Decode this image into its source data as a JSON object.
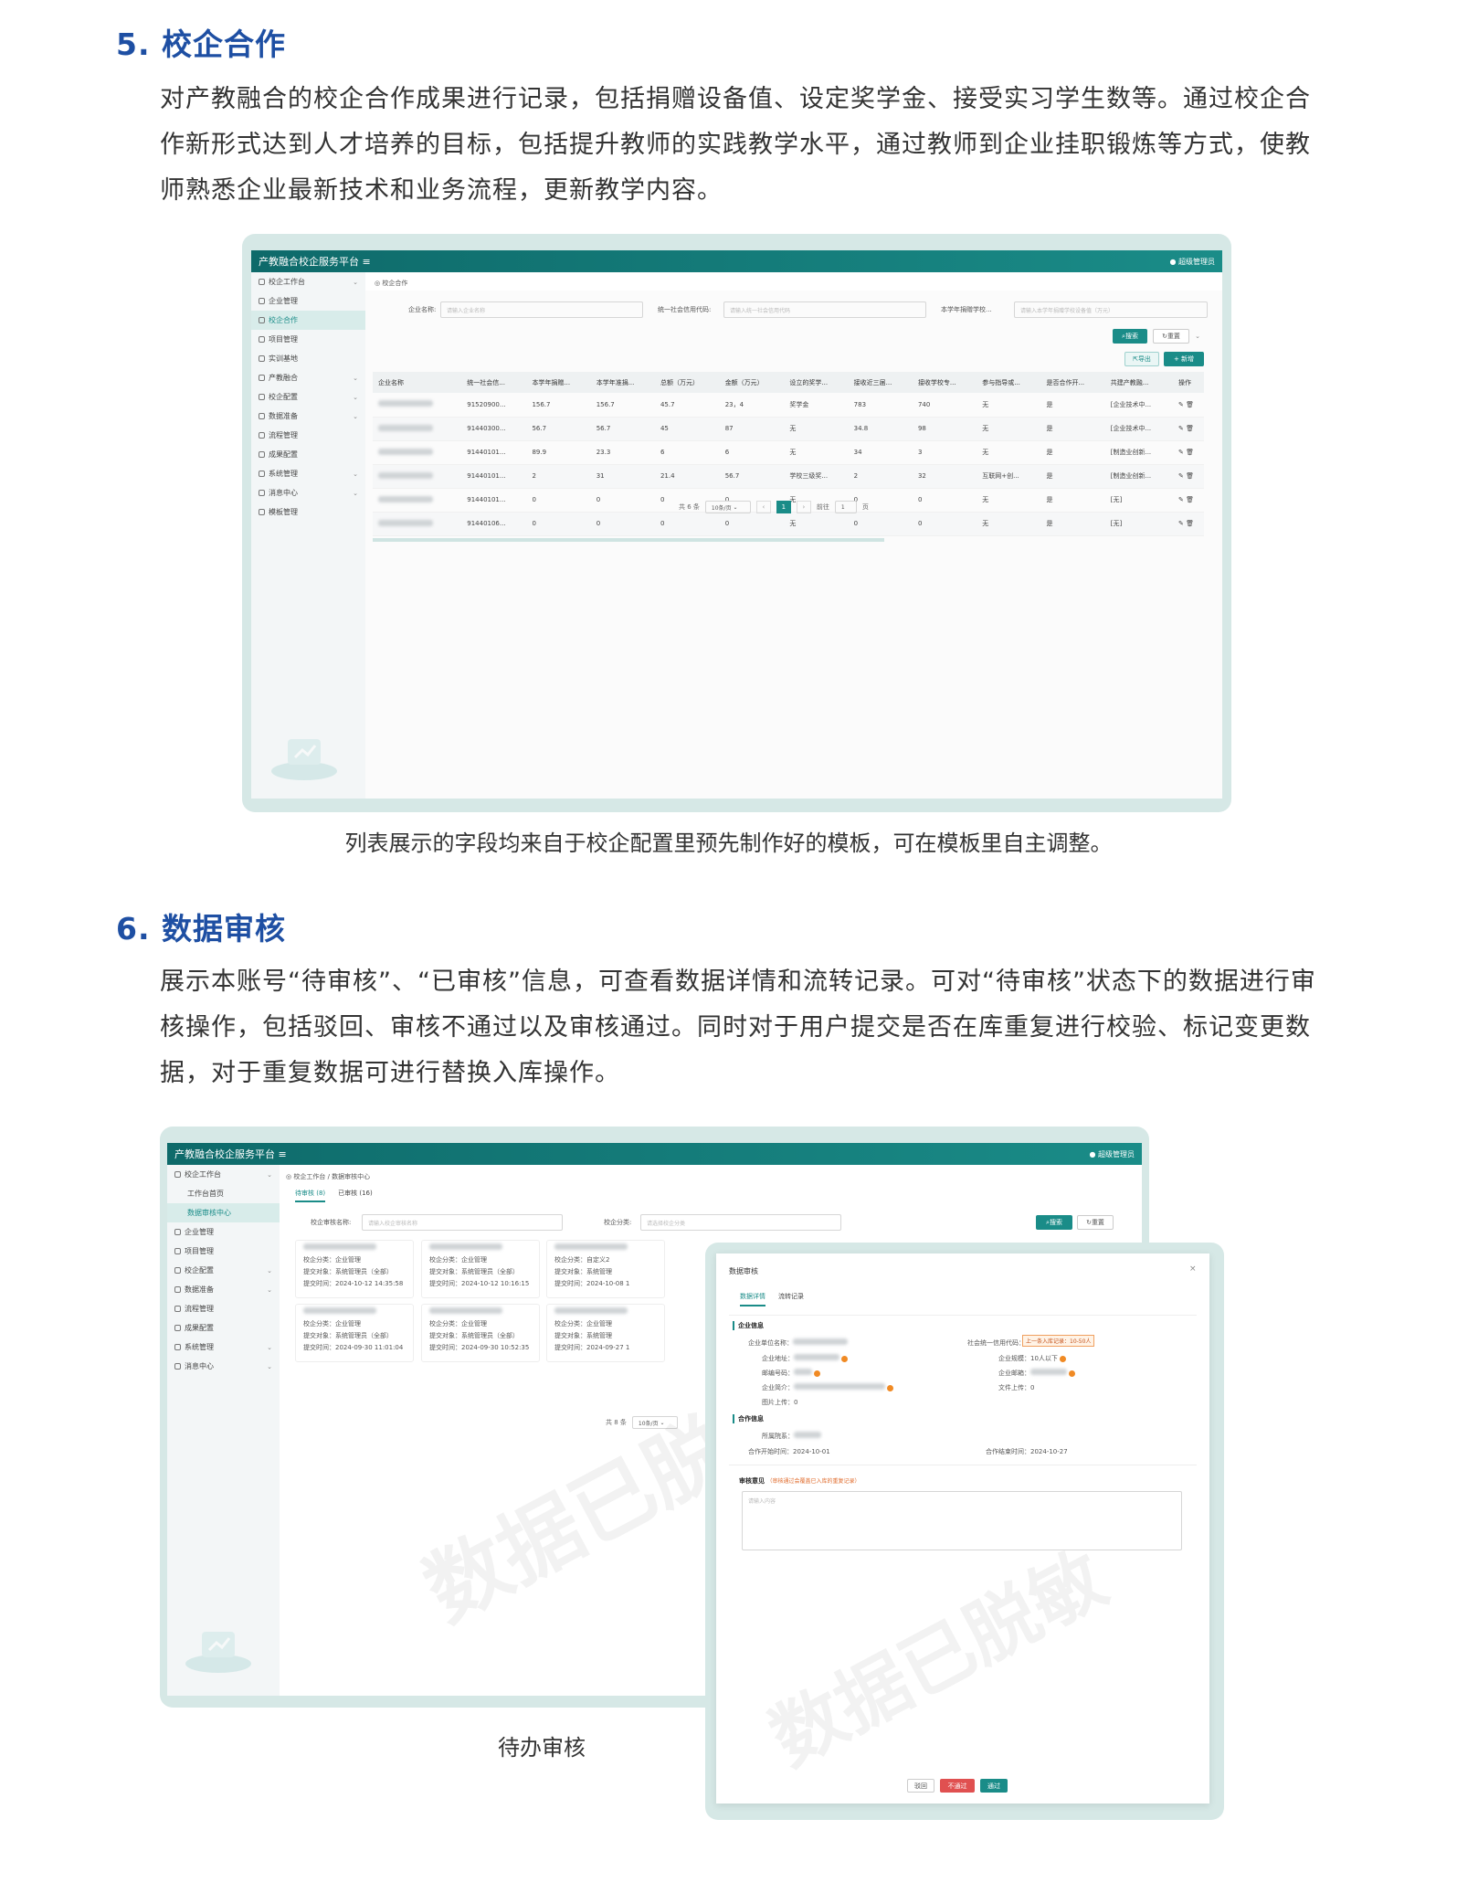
{
  "section5": {
    "heading": "5. 校企合作",
    "para": "对产教融合的校企合作成果进行记录，包括捐赠设备值、设定奖学金、接受实习学生数等。通过校企合作新形式达到人才培养的目标，包括提升教师的实践教学水平，通过教师到企业挂职锻炼等方式，使教师熟悉企业最新技术和业务流程，更新教学内容。",
    "caption": "列表展示的字段均来自于校企配置里预先制作好的模板，可在模板里自主调整。"
  },
  "section6": {
    "heading": "6. 数据审核",
    "para": "展示本账号“待审核”、“已审核”信息，可查看数据详情和流转记录。可对“待审核”状态下的数据进行审核操作，包括驳回、审核不通过以及审核通过。同时对于用户提交是否在库重复进行校验、标记变更数据，对于重复数据可进行替换入库操作。",
    "caption": "待办审核"
  },
  "app": {
    "title": "产教融合校企服务平台",
    "user": "超级管理员"
  },
  "shot1": {
    "breadcrumb": "校企合作",
    "sidebar": [
      "校企工作台",
      "企业管理",
      "校企合作",
      "项目管理",
      "实训基地",
      "产教融合",
      "校企配置",
      "数据准备",
      "流程管理",
      "成果配置",
      "系统管理",
      "消息中心",
      "模板管理"
    ],
    "filters": {
      "company_label": "企业名称:",
      "company_ph": "请输入企业名称",
      "credit_label": "统一社会信用代码:",
      "credit_ph": "请输入统一社会信用代码",
      "donate_label": "本学年捐赠学校...",
      "donate_ph": "请输入本学年捐赠学校设备值（万元）"
    },
    "btn_search": "搜索",
    "btn_reset": "重置",
    "btn_export": "导出",
    "btn_add": "+ 新增",
    "columns": [
      "企业名称",
      "统一社会信...",
      "本学年捐赠...",
      "本学年准捐...",
      "总额（万元）",
      "金额（万元）",
      "设立的奖学...",
      "接收近三届...",
      "接收学校专...",
      "参与指导或...",
      "是否合作开...",
      "共建产教融...",
      "操作"
    ],
    "rows": [
      [
        "91520900...",
        "156.7",
        "156.7",
        "45.7",
        "23，4",
        "奖学金",
        "783",
        "740",
        "无",
        "是",
        "[企业技术中..."
      ],
      [
        "91440300...",
        "56.7",
        "56.7",
        "45",
        "87",
        "无",
        "34.8",
        "98",
        "无",
        "是",
        "[企业技术中..."
      ],
      [
        "91440101...",
        "89.9",
        "23.3",
        "6",
        "6",
        "无",
        "34",
        "3",
        "无",
        "是",
        "[制造业创新..."
      ],
      [
        "91440101...",
        "2",
        "31",
        "21.4",
        "56.7",
        "学校三级奖...",
        "2",
        "32",
        "互联网+创...",
        "是",
        "[制造业创新..."
      ],
      [
        "91440101...",
        "0",
        "0",
        "0",
        "0",
        "无",
        "0",
        "0",
        "无",
        "是",
        "[无]"
      ],
      [
        "91440106...",
        "0",
        "0",
        "0",
        "0",
        "无",
        "0",
        "0",
        "无",
        "是",
        "[无]"
      ]
    ],
    "pager": {
      "total": "共 6 条",
      "size": "10条/页",
      "page": "1",
      "goto": "前往",
      "goto_val": "1",
      "suffix": "页"
    }
  },
  "shot2": {
    "breadcrumb": "校企工作台 / 数据审核中心",
    "sidebar": [
      "校企工作台",
      "工作台首页",
      "数据审核中心",
      "企业管理",
      "项目管理",
      "校企配置",
      "数据准备",
      "流程管理",
      "成果配置",
      "系统管理",
      "消息中心"
    ],
    "tabs": [
      "待审核 (8)",
      "已审核 (16)"
    ],
    "name_label": "校企审核名称:",
    "name_ph": "请输入校企审核名称",
    "cat_label": "校企分类:",
    "cat_ph": "请选择校企分类",
    "btn_search": "搜索",
    "btn_reset": "重置",
    "cards": [
      [
        "校企分类：企业管理",
        "提交对象：系统管理员（全部）",
        "提交时间：2024-10-12 14:35:58"
      ],
      [
        "校企分类：企业管理",
        "提交对象：系统管理员（全部）",
        "提交时间：2024-10-12 10:16:15"
      ],
      [
        "校企分类：自定义2",
        "提交对象：系统管理",
        "提交时间：2024-10-08 1"
      ],
      [
        "校企分类：企业管理",
        "提交对象：系统管理员（全部）",
        "提交时间：2024-09-30 11:01:04"
      ],
      [
        "校企分类：企业管理",
        "提交对象：系统管理员（全部）",
        "提交时间：2024-09-30 10:52:35"
      ],
      [
        "校企分类：企业管理",
        "提交对象：系统管理",
        "提交时间：2024-09-27 1"
      ]
    ],
    "pager_total": "共 8 条",
    "pager_size": "10条/页",
    "watermark": "数据已脱敏"
  },
  "dialog": {
    "title": "数据审核",
    "tabs": [
      "数据详情",
      "流转记录"
    ],
    "sec1": "企业信息",
    "f_name": "企业单位名称：",
    "f_credit": "社会统一信用代码：",
    "tooltip": "上一条入库记录：10-50人",
    "f_addr": "企业地址：",
    "f_scale": "企业规模：",
    "f_scale_val": "10人以下",
    "f_zip": "邮编号码：",
    "f_mail": "企业邮箱：",
    "f_intro": "企业简介：",
    "f_file": "文件上传：",
    "f_file_val": "0",
    "f_pic": "图片上传：",
    "f_pic_val": "0",
    "sec2": "合作信息",
    "f_sys": "所属院系：",
    "f_start": "合作开始时间：",
    "f_start_val": "2024-10-01",
    "f_end": "合作结束时间：",
    "f_end_val": "2024-10-27",
    "opinion": "审核意见",
    "opinion_hint": "（审核通过会覆盖已入库的重复记录）",
    "opinion_ph": "请输入内容",
    "btn_reject": "驳回",
    "btn_fail": "不通过",
    "btn_pass": "通过",
    "watermark": "数据已脱敏"
  }
}
